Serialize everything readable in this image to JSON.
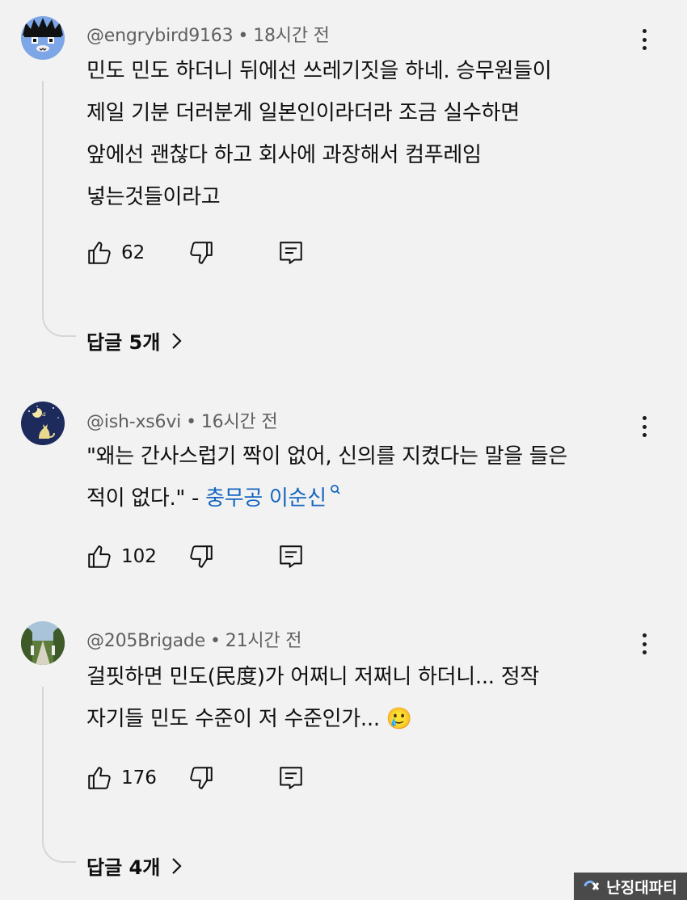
{
  "comments": [
    {
      "username": "@engrybird9163",
      "time": "18시간 전",
      "text": "민도 민도 하더니 뒤에선 쓰레기짓을 하네. 승무원들이\n제일 기분 더러분게 일본인이라더라 조금 실수하면\n앞에선 괜찮다 하고 회사에 과장해서 컴푸레임\n넣는것들이라고",
      "likes": "62",
      "replies": "답글 5개"
    },
    {
      "username": "@ish-xs6vi",
      "time": "16시간 전",
      "text": "\"왜는 간사스럽기 짝이 없어, 신의를 지켰다는 말을 들은\n적이 없다.\" - ",
      "link": "충무공 이순신",
      "likes": "102"
    },
    {
      "username": "@205Brigade",
      "time": "21시간 전",
      "text": "걸핏하면 민도(民度)가 어쩌니 저쩌니 하더니... 정작\n자기들 민도 수준이 저 수준인가... 🥲",
      "likes": "176",
      "replies": "답글 4개"
    }
  ],
  "watermark": "난징대파티",
  "colors": {
    "background": "#f2f2f2",
    "meta_text": "#606060",
    "link": "#1565c0",
    "thread_line": "#d6d6d6"
  },
  "icons": [
    "thumbs-up-icon",
    "thumbs-down-icon",
    "reply-icon",
    "more-vert-icon",
    "chevron-right-icon",
    "search-icon"
  ]
}
